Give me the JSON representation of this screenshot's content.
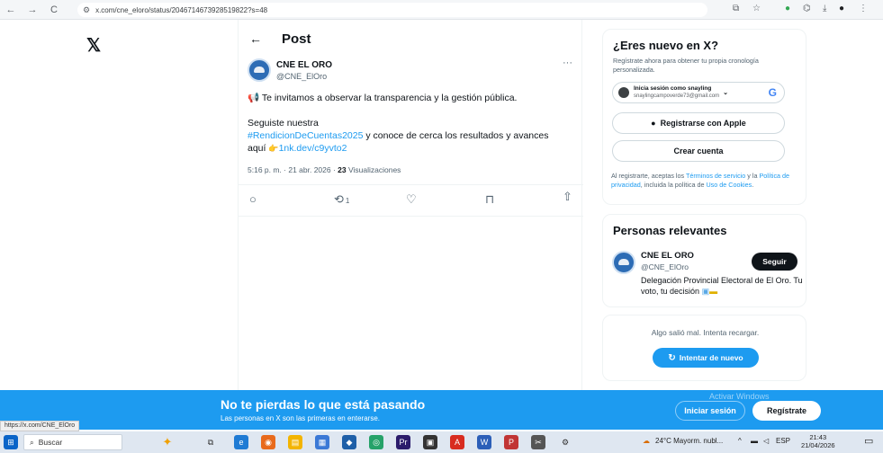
{
  "browser": {
    "url": "x.com/cne_eloro/status/2046714673928519822?s=48",
    "nav_back": "←",
    "nav_forward": "→",
    "nav_reload": "C"
  },
  "left_nav": {
    "logo": "𝕏"
  },
  "post": {
    "header_title": "Post",
    "back_arrow": "←",
    "author_name": "CNE EL ORO",
    "author_handle": "@CNE_ElOro",
    "more": "···",
    "line1": "Te invitamos a observar la transparencia y la gestión pública.",
    "line2": "Seguiste nuestra",
    "hashtag": "#RendicionDeCuentas2025",
    "line3": " y conoce de cerca los resultados y avances",
    "line4_prefix": "aquí ",
    "link": "1nk.dev/c9yvto2",
    "timestamp": "5:16 p. m. · 21 abr. 2026 · ",
    "views": "23",
    "views_label": " Visualizaciones",
    "retweet_count": "1"
  },
  "signup": {
    "title": "¿Eres nuevo en X?",
    "subtitle": "Regístrate ahora para obtener tu propia cronología personalizada.",
    "google_label": "Inicia sesión como snayling",
    "google_email": "snaylingcampoverde73@gmail.com",
    "apple_label": "Registrarse con Apple",
    "create_label": "Crear cuenta",
    "legal_1": "Al registrarte, aceptas los ",
    "legal_terms": "Términos de servicio",
    "legal_2": " y la ",
    "legal_privacy": "Política de privacidad",
    "legal_3": ", incluida la política de ",
    "legal_cookies": "Uso de Cookies",
    "legal_4": "."
  },
  "relevant": {
    "title": "Personas relevantes",
    "name": "CNE EL ORO",
    "handle": "@CNE_ElOro",
    "follow_label": "Seguir",
    "bio": "Delegación Provincial Electoral de El Oro. Tu voto, tu decisión"
  },
  "error_card": {
    "message": "Algo salió mal. Intenta recargar.",
    "retry_label": "Intentar de nuevo"
  },
  "banner": {
    "title": "No te pierdas lo que está pasando",
    "subtitle": "Las personas en X son las primeras en enterarse.",
    "login_label": "Iniciar sesión",
    "register_label": "Regístrate",
    "windows_watermark": "Activar Windows"
  },
  "status_url": "https://x.com/CNE_ElOro",
  "taskbar": {
    "search_placeholder": "Buscar",
    "weather": "24°C Mayorm. nubl...",
    "lang": "ESP",
    "time": "21:43",
    "date": "21/04/2026"
  },
  "colors": {
    "accent": "#1d9bf0",
    "text": "#0f1419",
    "muted": "#536471"
  }
}
